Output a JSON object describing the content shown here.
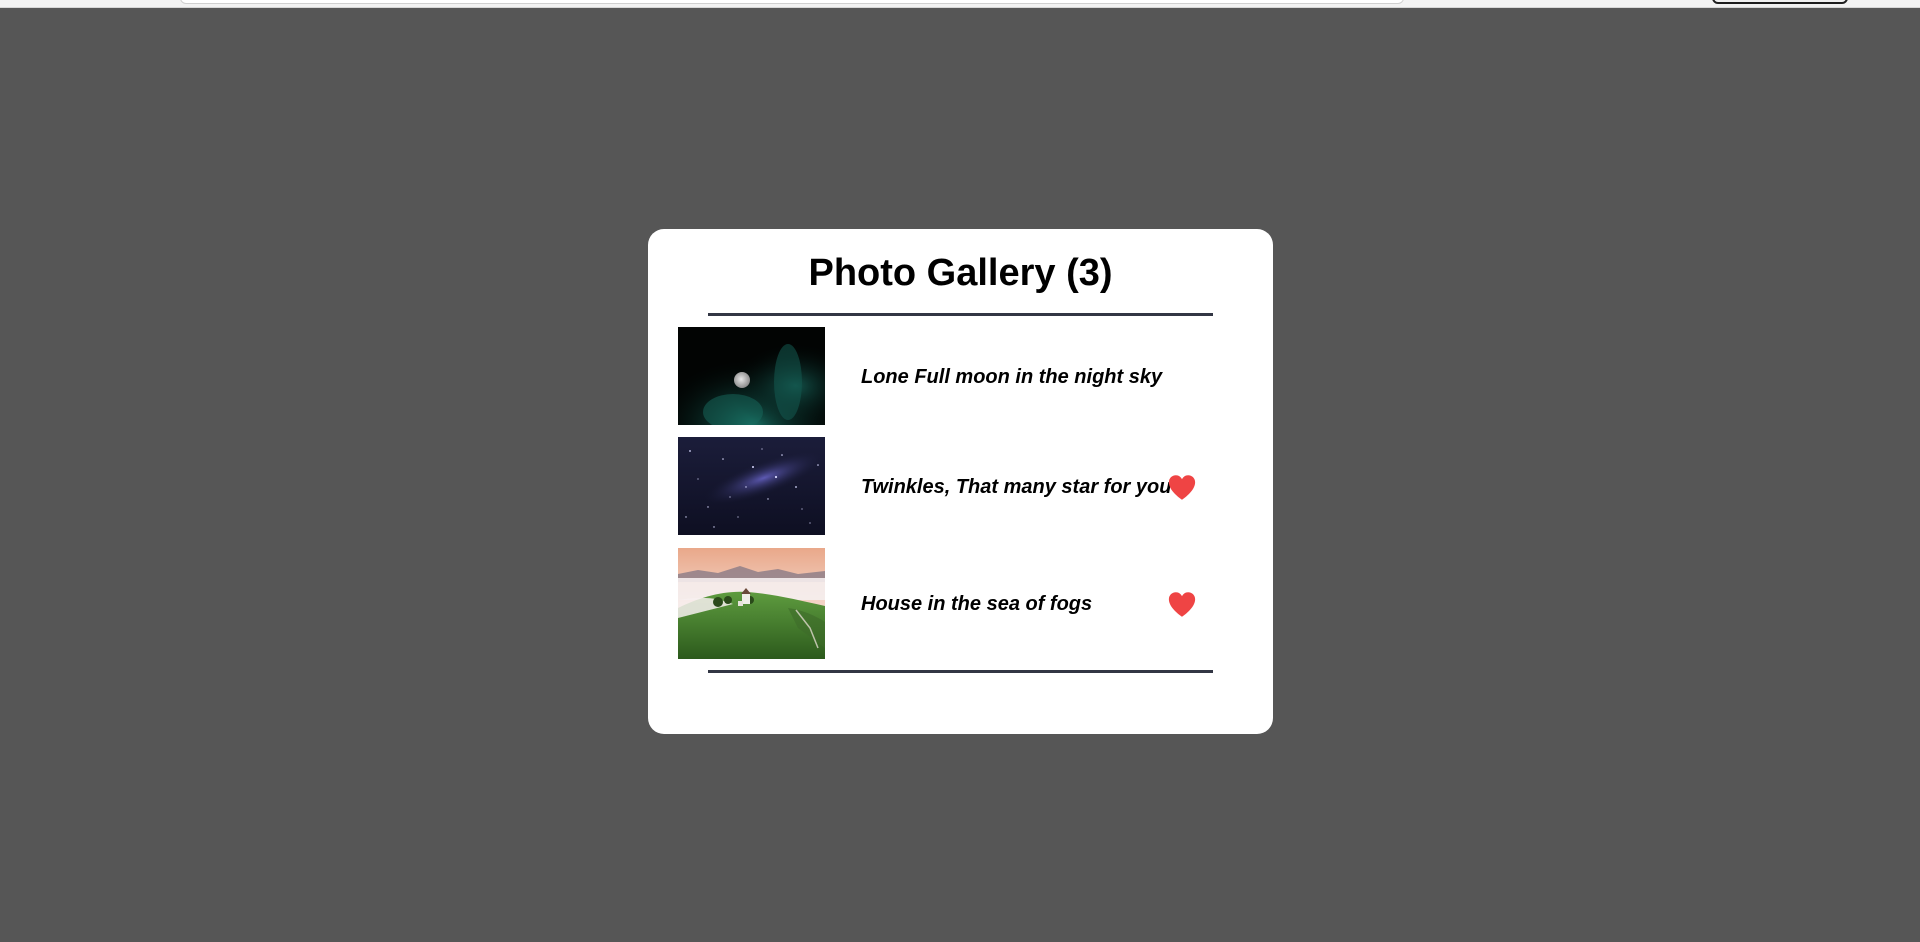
{
  "gallery": {
    "title": "Photo Gallery (3)",
    "items": [
      {
        "caption": "Lone Full moon in the night sky",
        "liked": false,
        "thumbnail": "full-moon-night-sky"
      },
      {
        "caption": "Twinkles, That many star for you",
        "liked": true,
        "thumbnail": "starry-milky-way"
      },
      {
        "caption": "House in the sea of fogs",
        "liked": true,
        "thumbnail": "house-in-fog-hills"
      }
    ]
  },
  "colors": {
    "page_background": "#565656",
    "card_background": "#ffffff",
    "divider": "#323644",
    "heart": "#ef4444"
  },
  "icons": {
    "like": "heart-icon"
  }
}
